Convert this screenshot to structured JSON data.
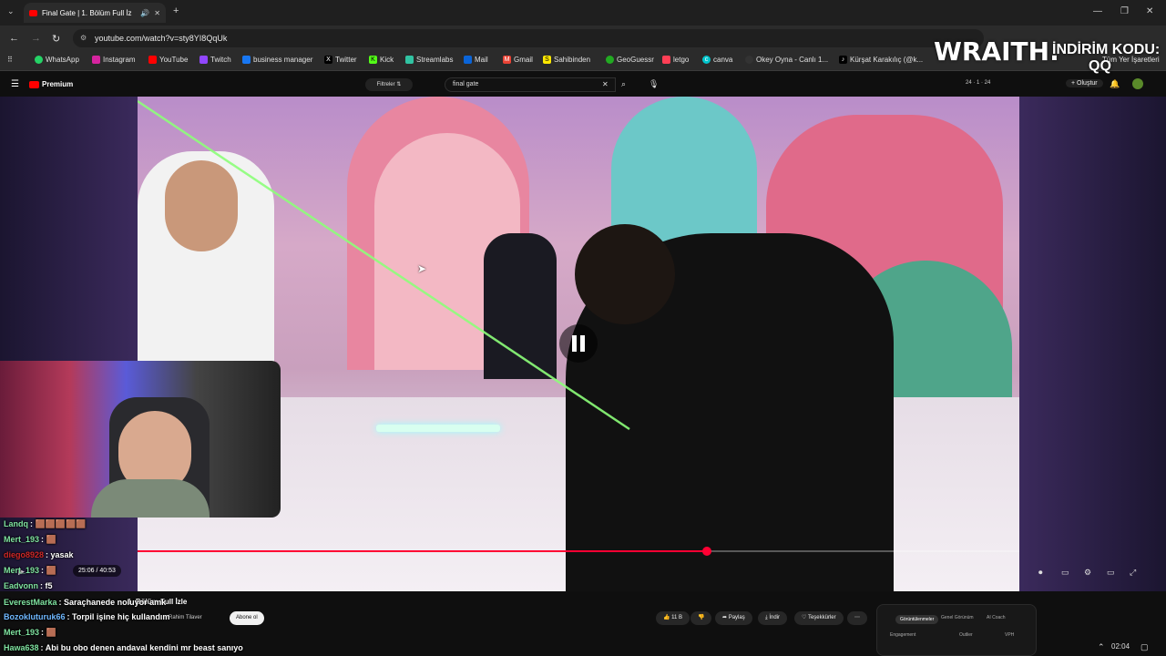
{
  "browser": {
    "tab_title": "Final Gate | 1. Bölüm Full İz",
    "url": "youtube.com/watch?v=sty8YI8QqUk",
    "bookmarks": [
      "WhatsApp",
      "Instagram",
      "YouTube",
      "Twitch",
      "business manager",
      "Twitter",
      "Kick",
      "Streamlabs",
      "Mail",
      "Gmail",
      "Sahibinden",
      "GeoGuessr",
      "letgo",
      "canva",
      "Okey Oyna - Canlı 1...",
      "Kürşat Karakılıç (@k...",
      "Tüm Yer İşaretleri"
    ]
  },
  "youtube": {
    "logo": "Premium",
    "filter_chip": "Filtreler",
    "search_value": "final gate",
    "counters": "24 · 1 · 24",
    "create_label": "Oluştur",
    "time_display": "25:06 / 40:53",
    "progress_fraction": 0.646,
    "video_title_partial": "1. Bölüm Full İzle",
    "channel_name": "Rahim Tilaver",
    "subscribe_label": "Abone ol",
    "like_count": "11 B",
    "share_label": "Paylaş",
    "download_label": "İndir",
    "thanks_label": "Teşekkürler",
    "panel_tabs": [
      "Görüntülenmeler",
      "Genel Görünüm",
      "AI Coach"
    ],
    "panel_cols": [
      "Engagement",
      "Outlier",
      "VPH"
    ]
  },
  "overlay": {
    "brand": "WRAITH.",
    "promo_line1": "İNDİRİM KODU:",
    "promo_line2": "QQ"
  },
  "chat": [
    {
      "user": "Landq",
      "text": ": 🟫🟫🟫🟫🟫",
      "color": "#7fe3a0"
    },
    {
      "user": "Mert_193",
      "text": ": 🟫",
      "color": "#7fe3a0"
    },
    {
      "user": "diego8928",
      "text": ": yasak",
      "color": "#d02828"
    },
    {
      "user": "Mert_193",
      "text": ": 🟫",
      "color": "#7fe3a0"
    },
    {
      "user": "Eadvonn",
      "text": ": f5",
      "color": "#7fe3a0"
    },
    {
      "user": "EverestMarka",
      "text": ": Saraçhanede noluyor amk",
      "color": "#7fe3a0"
    },
    {
      "user": "Bozokluturuk66",
      "text": ": Torpil işine hiç kullandım",
      "color": "#6fb8ff"
    },
    {
      "user": "Mert_193",
      "text": ": 🟫",
      "color": "#7fe3a0"
    },
    {
      "user": "Hawa638",
      "text": ": Abi bu obo denen andaval kendini mr beast sanıyo",
      "color": "#7fe3a0"
    }
  ],
  "taskbar": {
    "time": "02:04"
  }
}
